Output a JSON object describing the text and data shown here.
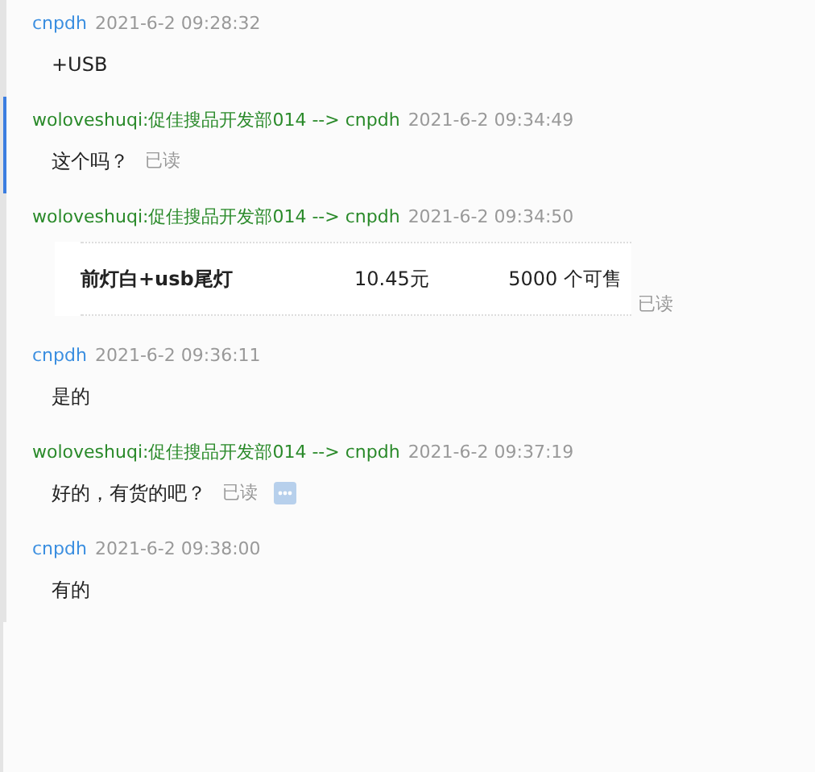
{
  "messages": [
    {
      "sender": "cnpdh",
      "kind": "text",
      "outgoing": false,
      "selected": false,
      "time": "2021-6-2 09:28:32",
      "text": "+USB"
    },
    {
      "sender": "woloveshuqi:促佳搜品开发部014 --> cnpdh",
      "kind": "text",
      "outgoing": true,
      "selected": true,
      "time": "2021-6-2 09:34:49",
      "text": "这个吗？",
      "read": "已读"
    },
    {
      "sender": "woloveshuqi:促佳搜品开发部014 --> cnpdh",
      "kind": "product",
      "outgoing": true,
      "selected": false,
      "time": "2021-6-2 09:34:50",
      "product": {
        "name": "前灯白+usb尾灯",
        "price": "10.45元",
        "stock": "5000 个可售"
      },
      "read": "已读"
    },
    {
      "sender": "cnpdh",
      "kind": "text",
      "outgoing": false,
      "selected": false,
      "time": "2021-6-2 09:36:11",
      "text": "是的"
    },
    {
      "sender": "woloveshuqi:促佳搜品开发部014 --> cnpdh",
      "kind": "text",
      "outgoing": true,
      "selected": false,
      "time": "2021-6-2 09:37:19",
      "text": "好的，有货的吧？",
      "read": "已读",
      "more": true
    },
    {
      "sender": "cnpdh",
      "kind": "text",
      "outgoing": false,
      "selected": false,
      "time": "2021-6-2 09:38:00",
      "text": "有的"
    }
  ]
}
